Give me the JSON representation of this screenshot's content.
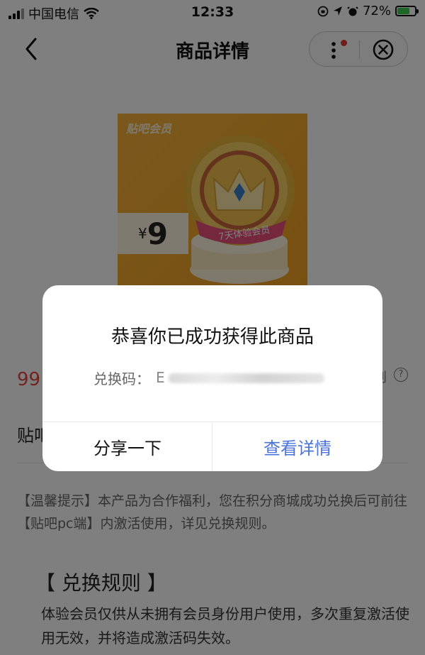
{
  "status_bar": {
    "carrier": "中国电信",
    "time": "12:33",
    "battery": "72%",
    "battery_level": 0.72
  },
  "nav": {
    "title": "商品详情",
    "icons": [
      "chevron-left-icon",
      "more-icon",
      "close-circle-icon"
    ]
  },
  "product": {
    "brand_tag": "贴吧会员",
    "price_currency": "¥",
    "price_value": "9",
    "ribbon_text": "7天体验会员",
    "points_price": "99",
    "name": "贴吧",
    "rule_link": "则",
    "colors": {
      "accent": "#f5b23c",
      "points": "#e2463b"
    }
  },
  "tips": {
    "text": "【温馨提示】本产品为合作福利，您在积分商城成功兑换后可前往【贴吧pc端】内激活使用，详见兑换规则。"
  },
  "rules": {
    "title": "【 兑换规则 】",
    "body": "体验会员仅供从未拥有会员身份用户使用，多次重复激活使用无效，并将造成激活码失效。"
  },
  "dialog": {
    "title": "恭喜你已成功获得此商品",
    "code_label": "兑换码：",
    "code_first_char": "E",
    "share_button": "分享一下",
    "detail_button": "查看详情",
    "colors": {
      "detail": "#4a73d9"
    }
  }
}
